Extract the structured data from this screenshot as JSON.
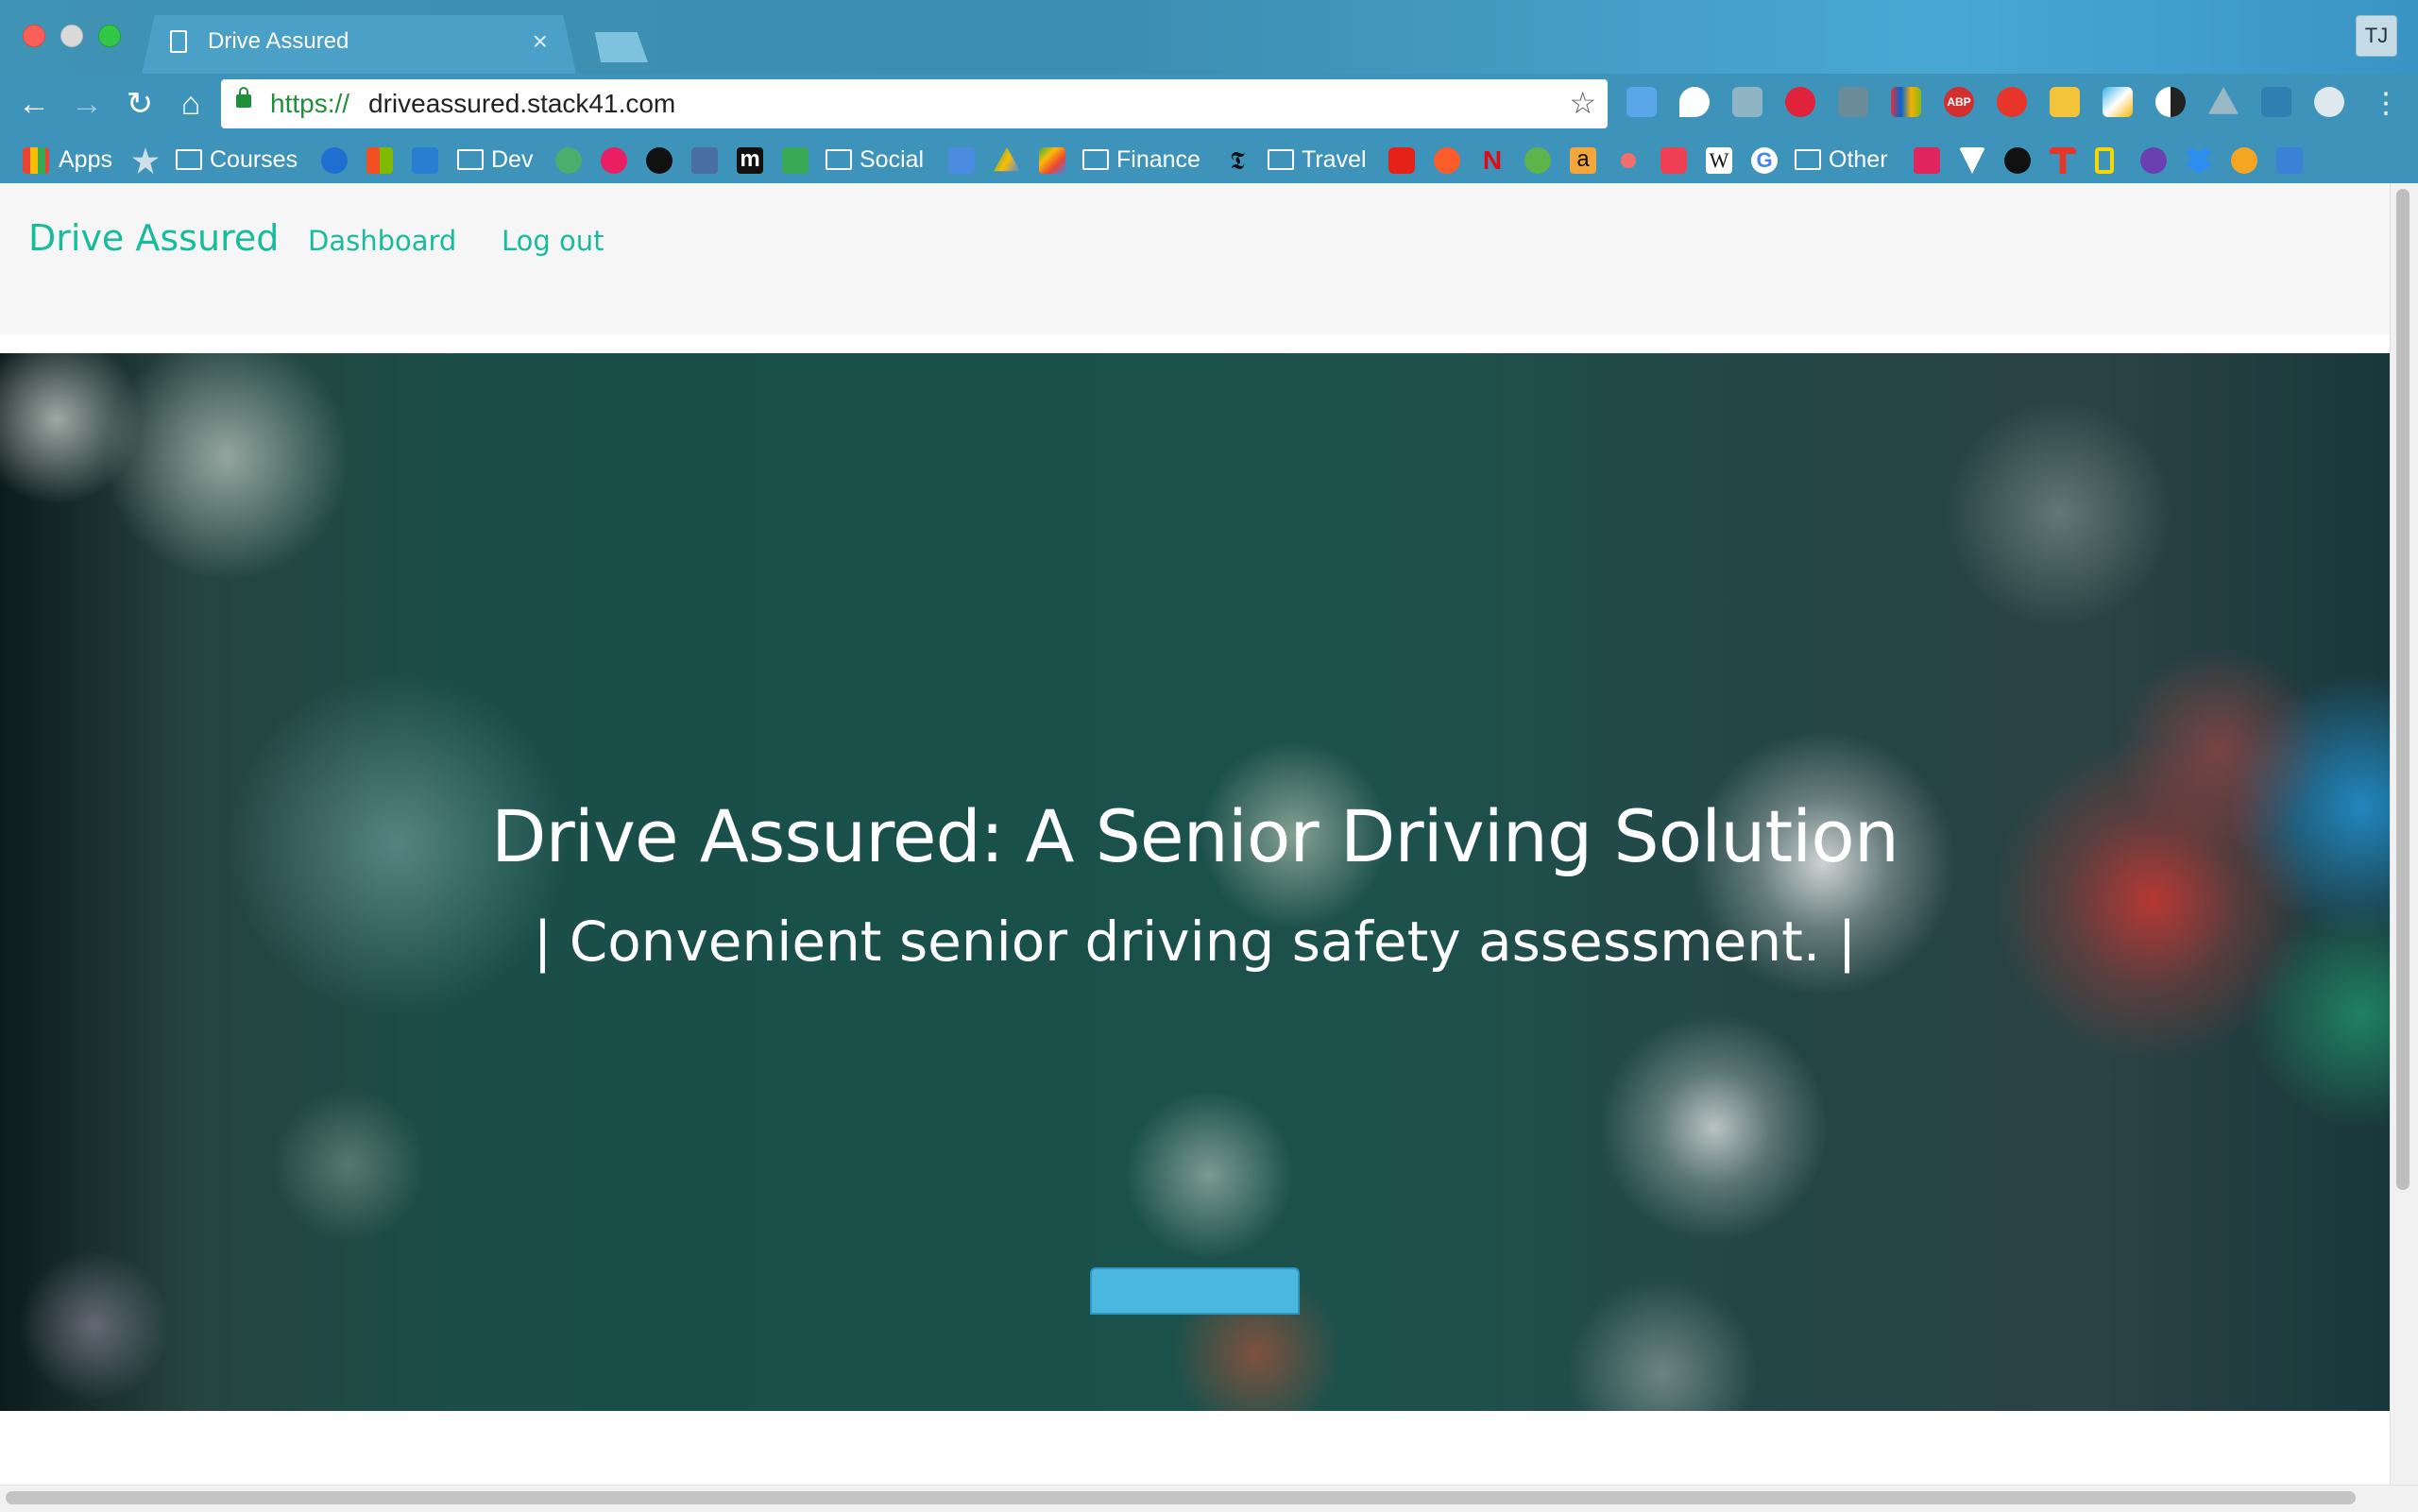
{
  "browser": {
    "tab_title": "Drive Assured",
    "tab_close": "×",
    "profile_initials": "TJ",
    "url_scheme": "https://",
    "url_host": "driveassured.stack41.com",
    "back_icon": "←",
    "forward_icon": "→",
    "reload_icon": "↻",
    "home_icon": "⌂",
    "star_icon": "☆",
    "menu_icon": "⋮"
  },
  "bookmarks": {
    "apps": "Apps",
    "courses": "Courses",
    "dev": "Dev",
    "social": "Social",
    "finance": "Finance",
    "travel": "Travel",
    "other": "Other",
    "medium_glyph": "m",
    "nyt_glyph": "𝕿",
    "netflix_glyph": "N",
    "amazon_glyph": "a",
    "wiki_glyph": "W",
    "google_glyph": "G",
    "abp_glyph": "ABP"
  },
  "site": {
    "brand": "Drive Assured",
    "nav": {
      "dashboard": "Dashboard",
      "logout": "Log out"
    },
    "hero": {
      "title": "Drive Assured: A Senior Driving Solution",
      "subtitle": "| Convenient senior driving safety assessment. |"
    }
  },
  "colors": {
    "accent": "#18bc9c",
    "chrome": "#3e93ba",
    "cta": "#4bb7df"
  }
}
